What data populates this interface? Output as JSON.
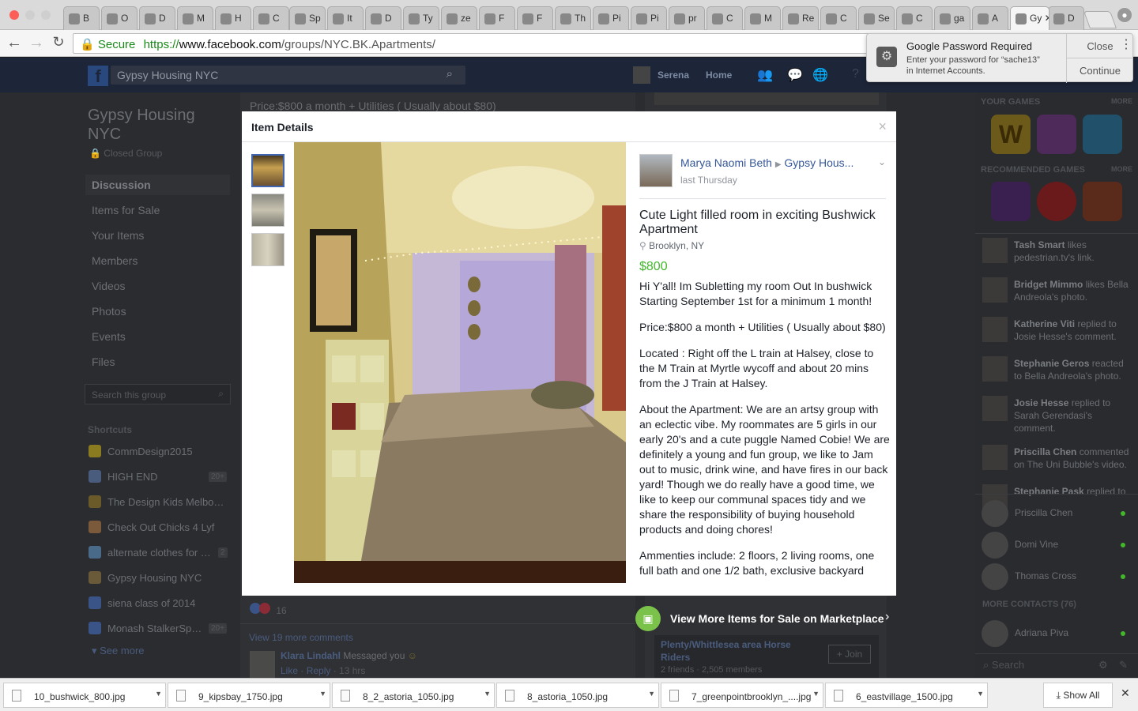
{
  "browser": {
    "tabs": [
      {
        "icon": "doc",
        "label": "B"
      },
      {
        "icon": "circle",
        "label": "O"
      },
      {
        "icon": "zen",
        "label": "D"
      },
      {
        "icon": "fc",
        "label": "M"
      },
      {
        "icon": "F",
        "label": "H"
      },
      {
        "icon": "figure",
        "label": "C"
      },
      {
        "icon": "gear",
        "label": "Sp"
      },
      {
        "icon": "globe",
        "label": "It"
      },
      {
        "icon": "pinterest-dark",
        "label": "D"
      },
      {
        "icon": "T",
        "label": "Ty"
      },
      {
        "icon": "bar",
        "label": "ze"
      },
      {
        "icon": "FJ",
        "label": "F"
      },
      {
        "icon": "FJ",
        "label": "F"
      },
      {
        "icon": "x",
        "label": "Th"
      },
      {
        "icon": "doc",
        "label": "Pi"
      },
      {
        "icon": "pinterest",
        "label": "Pi"
      },
      {
        "icon": "phone",
        "label": "pr"
      },
      {
        "icon": "doc",
        "label": "C"
      },
      {
        "icon": "blue",
        "label": "M"
      },
      {
        "icon": "blank",
        "label": "Re"
      },
      {
        "icon": "F",
        "label": "C"
      },
      {
        "icon": "C",
        "label": "Se"
      },
      {
        "icon": "dot",
        "label": "C"
      },
      {
        "icon": "G",
        "label": "ga"
      },
      {
        "icon": "red",
        "label": "A"
      },
      {
        "icon": "blank",
        "label": "Gy"
      },
      {
        "icon": "doc",
        "label": "D"
      }
    ],
    "address": {
      "secure_label": "Secure",
      "url_scheme": "https://",
      "url_host": "www.facebook.com",
      "url_path": "/groups/NYC.BK.Apartments/"
    }
  },
  "notification": {
    "title": "Google Password Required",
    "body_line1": "Enter your password for “sache13”",
    "body_line2": "in Internet Accounts.",
    "close_label": "Close",
    "continue_label": "Continue"
  },
  "fb_header": {
    "search_value": "Gypsy Housing NYC",
    "user_name": "Serena",
    "home_label": "Home"
  },
  "group": {
    "name_line1": "Gypsy Housing",
    "name_line2": "NYC",
    "privacy": "Closed Group",
    "nav": [
      "Discussion",
      "Items for Sale",
      "Your Items",
      "Members",
      "Videos",
      "Photos",
      "Events",
      "Files"
    ],
    "search_placeholder": "Search this group",
    "shortcuts_title": "Shortcuts",
    "shortcuts": [
      {
        "label": "CommDesign2015",
        "badge": ""
      },
      {
        "label": "HIGH END",
        "badge": "20+"
      },
      {
        "label": "The Design Kids Melbo…",
        "badge": ""
      },
      {
        "label": "Check Out Chicks 4 Lyf",
        "badge": ""
      },
      {
        "label": "alternate clothes for …",
        "badge": "2"
      },
      {
        "label": "Gypsy Housing NYC",
        "badge": ""
      },
      {
        "label": "siena class of 2014",
        "badge": ""
      },
      {
        "label": "Monash StalkerSp…",
        "badge": "20+"
      }
    ],
    "see_more": "See more"
  },
  "feed": {
    "top_text": "Price:$800 a month + Utilities ( Usually about $80)",
    "reactions_count": "16",
    "view_more_comments": "View 19 more comments",
    "comment_author": "Klara Lindahl",
    "comment_text": "Messaged you",
    "comment_like": "Like",
    "comment_reply": "Reply",
    "comment_time": "13 hrs"
  },
  "modal": {
    "title": "Item Details",
    "close": "×",
    "poster": "Marya Naomi Beth",
    "group_name": "Gypsy Hous...",
    "time": "last Thursday",
    "item_title_line1": "Cute Light filled room in exciting Bushwick",
    "item_title_line2": "Apartment",
    "location": "Brooklyn, NY",
    "price": "$800",
    "desc": [
      "Hi Y'all! Im Subletting my room Out In bushwick Starting September 1st for a minimum 1 month!",
      "Price:$800 a month + Utilities ( Usually about $80)",
      "Located : Right off the L train at Halsey, close to the M Train at Myrtle wycoff and about 20 mins from the J Train at Halsey.",
      "About the Apartment: We are an artsy group with an eclectic vibe. My roommates are 5 girls in our early 20's and a cute puggle Named Cobie! We are definitely a young and fun group, we like to Jam out to music, drink wine, and have fires in our back yard! Though we do really have a good time, we like to keep our communal spaces tidy and we share the responsibility of buying household products and doing chores!",
      "Ammenties include: 2 floors, 2 living rooms, one full bath and one 1/2 bath, exclusive backyard"
    ]
  },
  "marketplace": {
    "label": "View More Items for Sale on Marketplace",
    "ad_title": "Plenty/Whittlesea area Horse Riders",
    "ad_meta": "2 friends · 2,505 members",
    "join_label": "+ Join"
  },
  "right_col": {
    "your_games": "YOUR GAMES",
    "recommended_games": "RECOMMENDED GAMES",
    "more": "MORE",
    "activity": [
      {
        "name": "Tash Smart",
        "text": "likes pedestrian.tv's link."
      },
      {
        "name": "Bridget Mimmo",
        "text": "likes Bella Andreola's photo."
      },
      {
        "name": "Katherine Viti",
        "text": "replied to Josie Hesse's comment."
      },
      {
        "name": "Stephanie Geros",
        "text": "reacted to Bella Andreola's photo."
      },
      {
        "name": "Josie Hesse",
        "text": "replied to Sarah Gerendasi's comment."
      },
      {
        "name": "Priscilla Chen",
        "text": "commented on The Uni Bubble's video."
      },
      {
        "name": "Stephanie Pask",
        "text": "replied to"
      }
    ],
    "contacts": [
      "Priscilla Chen",
      "Domi Vine",
      "Thomas Cross"
    ],
    "more_contacts": "MORE CONTACTS (76)",
    "more_contact_1": "Adriana Piva",
    "search_placeholder": "Search"
  },
  "downloads": {
    "files": [
      "10_bushwick_800.jpg",
      "9_kipsbay_1750.jpg",
      "8_2_astoria_1050.jpg",
      "8_astoria_1050.jpg",
      "7_greenpointbrooklyn_....jpg",
      "6_eastvillage_1500.jpg"
    ],
    "show_all": "Show All"
  },
  "colors": {
    "fb_blue": "#4267b2",
    "price_green": "#42b72a",
    "secure_green": "#1a8a1a",
    "fb_header": "#1d2638"
  }
}
